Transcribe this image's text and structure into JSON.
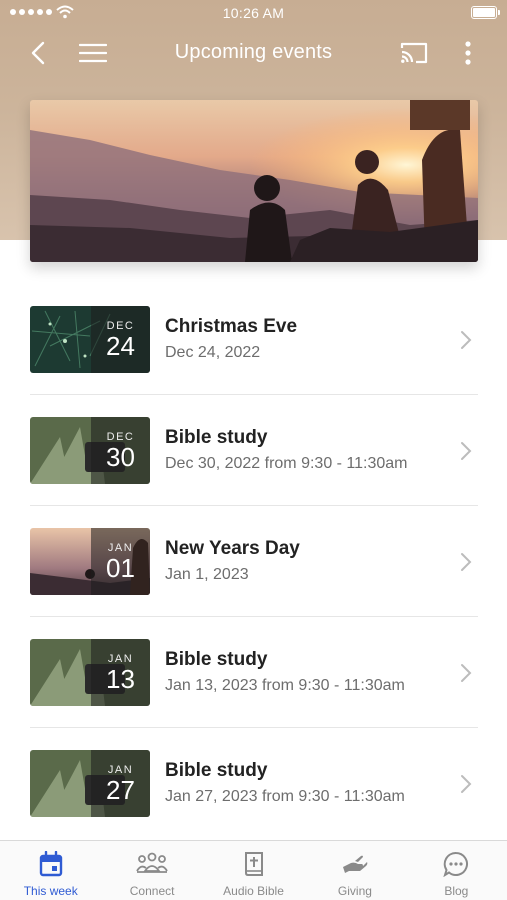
{
  "status_bar": {
    "time": "10:26 AM"
  },
  "nav": {
    "title": "Upcoming events",
    "back_icon": "chevron-left-icon",
    "menu_icon": "hamburger-icon",
    "cast_icon": "cast-icon",
    "more_icon": "more-vertical-icon"
  },
  "events": [
    {
      "title": "Christmas Eve",
      "subtitle": "Dec 24, 2022",
      "month": "DEC",
      "day": "24",
      "thumb": "tree"
    },
    {
      "title": "Bible study",
      "subtitle": "Dec 30, 2022 from 9:30 - 11:30am",
      "month": "DEC",
      "day": "30",
      "thumb": "bible"
    },
    {
      "title": "New Years Day",
      "subtitle": "Jan 1, 2023",
      "month": "JAN",
      "day": "01",
      "thumb": "sunset"
    },
    {
      "title": "Bible study",
      "subtitle": "Jan 13, 2023 from 9:30 - 11:30am",
      "month": "JAN",
      "day": "13",
      "thumb": "bible"
    },
    {
      "title": "Bible study",
      "subtitle": "Jan 27, 2023 from 9:30 - 11:30am",
      "month": "JAN",
      "day": "27",
      "thumb": "bible"
    }
  ],
  "tabs": [
    {
      "label": "This week",
      "icon": "calendar-icon",
      "active": true
    },
    {
      "label": "Connect",
      "icon": "people-icon",
      "active": false
    },
    {
      "label": "Audio Bible",
      "icon": "bible-icon",
      "active": false
    },
    {
      "label": "Giving",
      "icon": "giving-hand-icon",
      "active": false
    },
    {
      "label": "Blog",
      "icon": "chat-bubble-icon",
      "active": false
    }
  ],
  "colors": {
    "accent": "#2f5bd3",
    "header_bg": "#c7ad93",
    "inactive_tab": "#8a8a8a"
  }
}
